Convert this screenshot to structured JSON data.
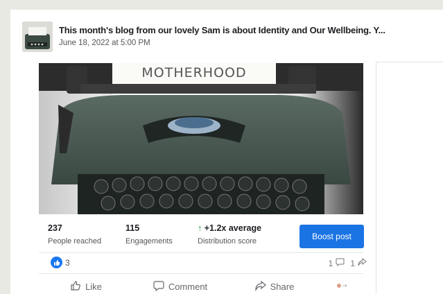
{
  "post": {
    "title": "This month's blog from our lovely Sam is about Identity and Our Wellbeing. Y...",
    "date": "June 18, 2022 at 5:00 PM",
    "image_text": "MOTHERHOOD"
  },
  "stats": {
    "reached": {
      "value": "237",
      "label": "People reached"
    },
    "engagements": {
      "value": "115",
      "label": "Engagements"
    },
    "distribution": {
      "value": "+1.2x average",
      "label": "Distribution score"
    }
  },
  "boost_label": "Boost post",
  "reactions": {
    "count": "3",
    "comments": "1",
    "shares": "1"
  },
  "actions": {
    "like": "Like",
    "comment": "Comment",
    "share": "Share"
  },
  "colors": {
    "accent": "#1b74e4",
    "like": "#1877f2",
    "positive": "#1a8f3a"
  }
}
